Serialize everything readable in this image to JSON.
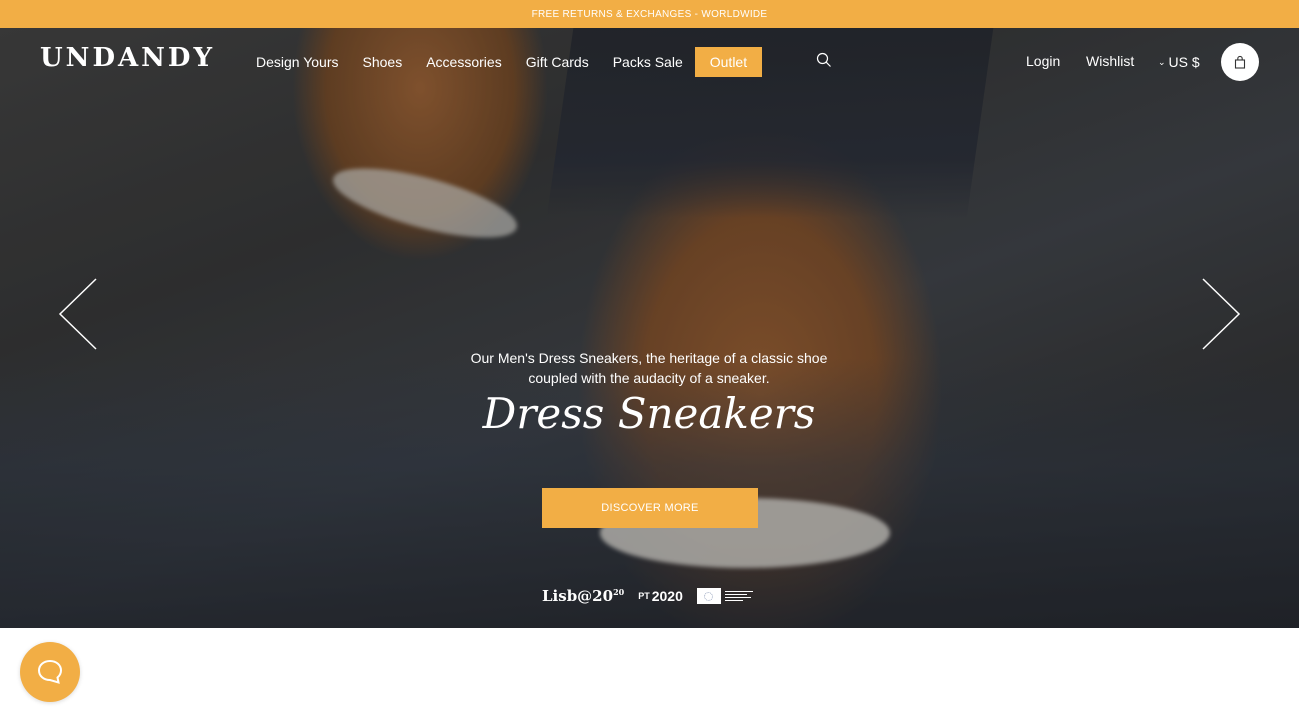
{
  "promo": {
    "text": "FREE RETURNS & EXCHANGES - WORLDWIDE"
  },
  "header": {
    "logo": "UNDANDY",
    "nav": [
      "Design Yours",
      "Shoes",
      "Accessories",
      "Gift Cards",
      "Packs Sale",
      "Outlet"
    ],
    "login": "Login",
    "wishlist": "Wishlist",
    "currency": "US $",
    "icons": {
      "search": "search-icon",
      "cart": "shopping-bag-icon",
      "currency_chevron": "chevron-down-icon"
    }
  },
  "hero": {
    "subtitle": "Our Men's Dress Sneakers, the heritage of a classic shoe coupled with the audacity of a sneaker.",
    "title": "Dress Sneakers",
    "cta": "DISCOVER MORE",
    "prev_icon": "chevron-left-icon",
    "next_icon": "chevron-right-icon"
  },
  "funding": {
    "lisboa": "Lisb@20",
    "lisboa_sup": "20",
    "portugal": "2020",
    "portugal_small": "PT"
  },
  "chat": {
    "icon": "chat-bubble-icon"
  },
  "colors": {
    "accent": "#f2ae45",
    "text_on_dark": "#ffffff"
  }
}
